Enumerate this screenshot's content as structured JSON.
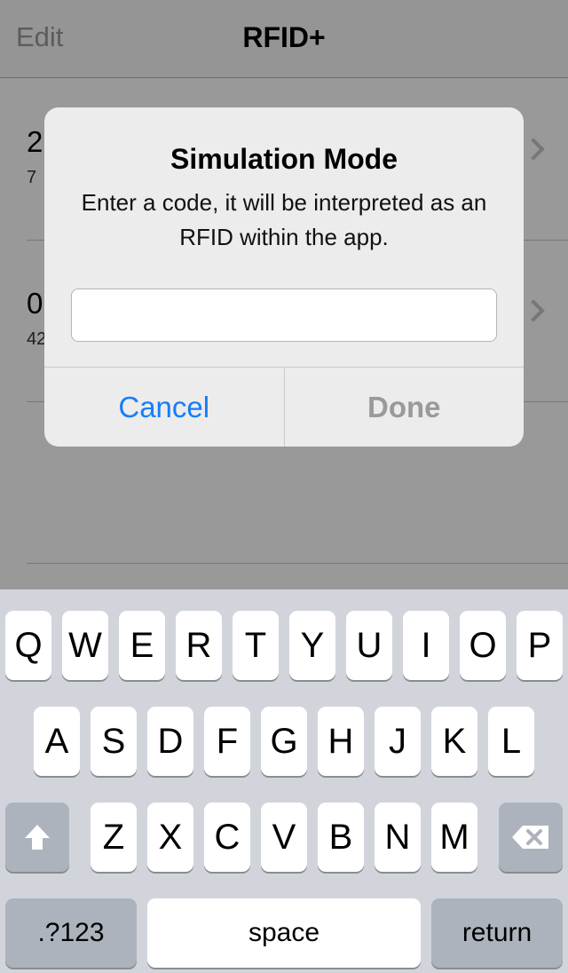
{
  "navbar": {
    "edit_label": "Edit",
    "title": "RFID+"
  },
  "list": {
    "rows": [
      {
        "title": "2",
        "subtitle": "7"
      },
      {
        "title": "0",
        "subtitle": "42"
      }
    ]
  },
  "alert": {
    "title": "Simulation Mode",
    "message": "Enter a code, it will be interpreted as an RFID within the app.",
    "input_value": "",
    "cancel_label": "Cancel",
    "done_label": "Done"
  },
  "keyboard": {
    "row1": [
      "Q",
      "W",
      "E",
      "R",
      "T",
      "Y",
      "U",
      "I",
      "O",
      "P"
    ],
    "row2": [
      "A",
      "S",
      "D",
      "F",
      "G",
      "H",
      "J",
      "K",
      "L"
    ],
    "row3": [
      "Z",
      "X",
      "C",
      "V",
      "B",
      "N",
      "M"
    ],
    "shift_icon": "shift-arrow-icon",
    "delete_icon": "backspace-icon",
    "numbers_label": ".?123",
    "space_label": "space",
    "return_label": "return"
  }
}
